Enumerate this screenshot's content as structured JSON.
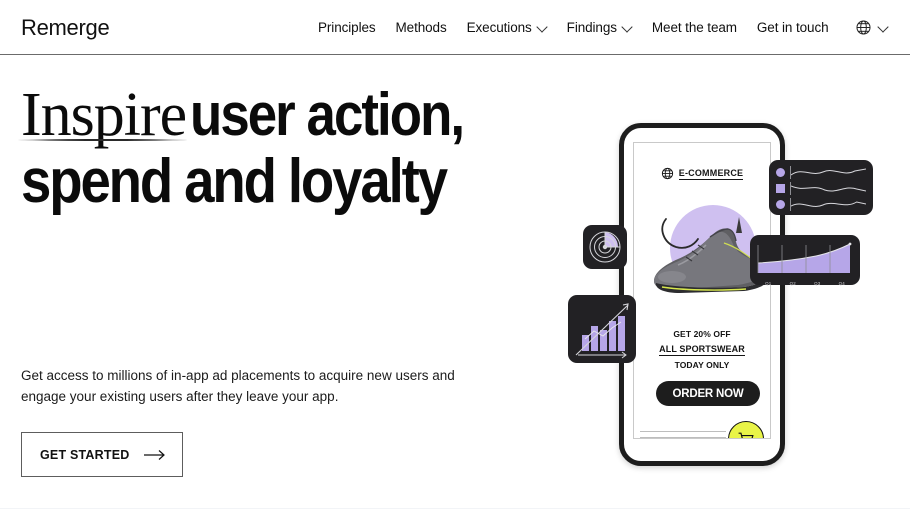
{
  "header": {
    "logo": "Remerge",
    "nav_items": [
      {
        "label": "Principles",
        "has_chevron": false
      },
      {
        "label": "Methods",
        "has_chevron": false
      },
      {
        "label": "Executions",
        "has_chevron": true
      },
      {
        "label": "Findings",
        "has_chevron": true
      },
      {
        "label": "Meet the team",
        "has_chevron": false
      },
      {
        "label": "Get in touch",
        "has_chevron": false
      }
    ],
    "language_selector": {
      "icon": "globe-icon",
      "chevron": "chevron-down-icon"
    }
  },
  "hero": {
    "headline_serif": "Inspire",
    "headline_rest": "user action,",
    "headline_line2": "spend and loyalty",
    "body": "Get access to millions of in-app ad placements to acquire new users and engage your existing users after they leave your app.",
    "cta_label": "GET STARTED",
    "cta_icon": "arrow-right-icon"
  },
  "illustration": {
    "phone": {
      "brand_label": "E-COMMERCE",
      "brand_icon": "globe-icon",
      "promo_line1": "GET 20% OFF",
      "promo_line2": "ALL SPORTSWEAR",
      "promo_line3": "TODAY ONLY",
      "order_button": "ORDER NOW",
      "cart_icon": "shopping-cart-icon",
      "product": "sneaker"
    },
    "widgets": {
      "metrics_rows": [
        {
          "marker": "circle"
        },
        {
          "marker": "square"
        },
        {
          "marker": "circle"
        }
      ],
      "area_chart_labels": [
        "Q1",
        "Q2",
        "Q3",
        "Q4"
      ],
      "bar_chart": {
        "bars": [
          22,
          38,
          30,
          46,
          58
        ]
      },
      "radar_widget": "radar-chart-icon"
    },
    "colors": {
      "purple": "#cfc0f0",
      "widget_purple": "#b6a6e8",
      "yellow": "#e9f448",
      "dark": "#222124"
    }
  }
}
